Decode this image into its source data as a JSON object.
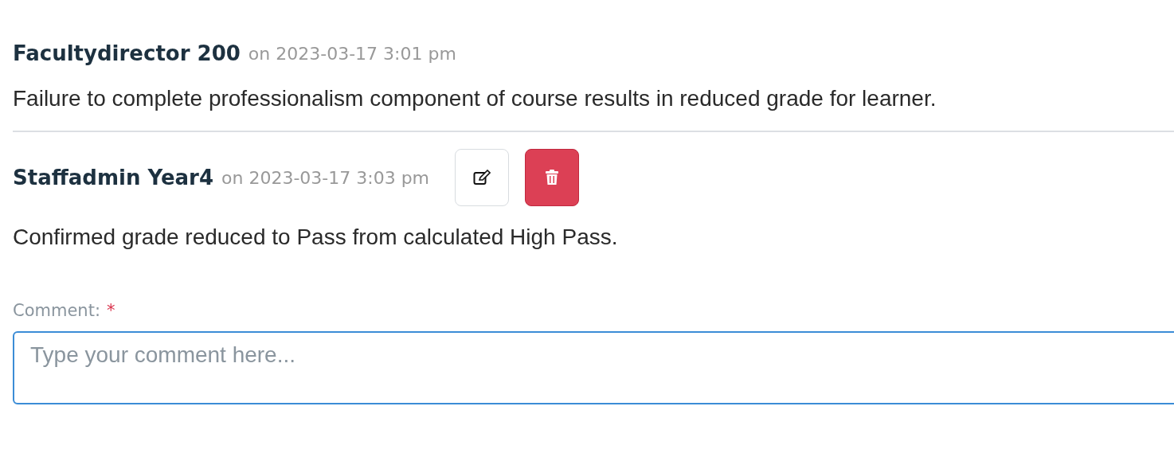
{
  "comments": [
    {
      "author": "Facultydirector 200",
      "timestamp": "on 2023-03-17 3:01 pm",
      "text": "Failure to complete professionalism component of course results in reduced grade for learner.",
      "editable": false
    },
    {
      "author": "Staffadmin Year4",
      "timestamp": "on 2023-03-17 3:03 pm",
      "text": "Confirmed grade reduced to Pass from calculated High Pass.",
      "editable": true
    }
  ],
  "comment_form": {
    "label": "Comment:",
    "required": true,
    "required_mark": "*",
    "placeholder": "Type your comment here..."
  }
}
